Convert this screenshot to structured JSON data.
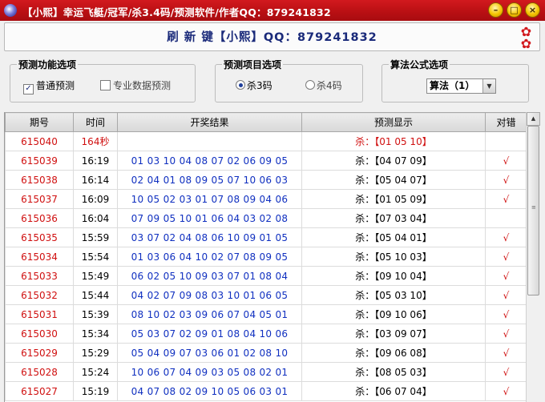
{
  "window": {
    "title": "【小熙】幸运飞艇/冠军/杀3.4码/预测软件/作者QQ：879241832"
  },
  "refresh": {
    "label": "刷 新 键【小熙】QQ：879241832"
  },
  "groups": {
    "function": {
      "title": "预测功能选项",
      "opt1": "普通预测",
      "opt1_checked": true,
      "opt2": "专业数据预测",
      "opt2_checked": false
    },
    "project": {
      "title": "预测项目选项",
      "opt1": "杀3码",
      "opt2": "杀4码",
      "selected": "杀3码"
    },
    "algorithm": {
      "title": "算法公式选项",
      "selected": "算法（1）"
    }
  },
  "table": {
    "headers": [
      "期号",
      "时间",
      "开奖结果",
      "预测显示",
      "对错"
    ],
    "rows": [
      [
        "615040",
        "164秒",
        "",
        "杀：【01 05 10】",
        ""
      ],
      [
        "615039",
        "16:19",
        "01 03 10 04 08 07 02 06 09 05",
        "杀：【04 07 09】",
        "√"
      ],
      [
        "615038",
        "16:14",
        "02 04 01 08 09 05 07 10 06 03",
        "杀：【05 04 07】",
        "√"
      ],
      [
        "615037",
        "16:09",
        "10 05 02 03 01 07 08 09 04 06",
        "杀：【01 05 09】",
        "√"
      ],
      [
        "615036",
        "16:04",
        "07 09 05 10 01 06 04 03 02 08",
        "杀：【07 03 04】",
        ""
      ],
      [
        "615035",
        "15:59",
        "03 07 02 04 08 06 10 09 01 05",
        "杀：【05 04 01】",
        "√"
      ],
      [
        "615034",
        "15:54",
        "01 03 06 04 10 02 07 08 09 05",
        "杀：【05 10 03】",
        "√"
      ],
      [
        "615033",
        "15:49",
        "06 02 05 10 09 03 07 01 08 04",
        "杀：【09 10 04】",
        "√"
      ],
      [
        "615032",
        "15:44",
        "04 02 07 09 08 03 10 01 06 05",
        "杀：【05 03 10】",
        "√"
      ],
      [
        "615031",
        "15:39",
        "08 10 02 03 09 06 07 04 05 01",
        "杀：【09 10 06】",
        "√"
      ],
      [
        "615030",
        "15:34",
        "05 03 07 02 09 01 08 04 10 06",
        "杀：【03 09 07】",
        "√"
      ],
      [
        "615029",
        "15:29",
        "05 04 09 07 03 06 01 02 08 10",
        "杀：【09 06 08】",
        "√"
      ],
      [
        "615028",
        "15:24",
        "10 06 07 04 09 03 05 08 02 01",
        "杀：【08 05 03】",
        "√"
      ],
      [
        "615027",
        "15:19",
        "04 07 08 02 09 10 05 06 03 01",
        "杀：【06 07 04】",
        "√"
      ]
    ]
  }
}
